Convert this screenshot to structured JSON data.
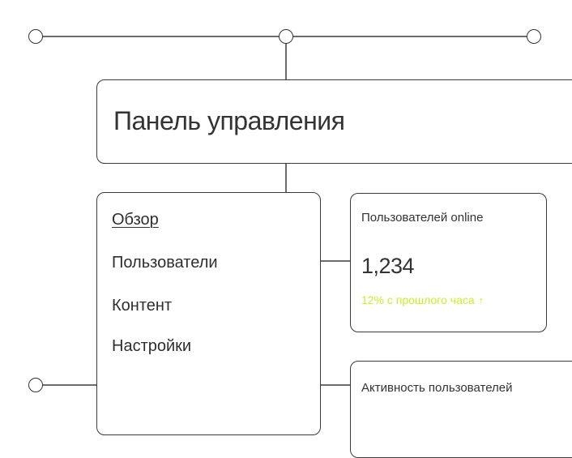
{
  "header": {
    "title": "Панель управления"
  },
  "sidebar": {
    "items": [
      {
        "label": "Обзор",
        "active": true
      },
      {
        "label": "Пользователи",
        "active": false
      },
      {
        "label": "Контент",
        "active": false
      },
      {
        "label": "Настройки",
        "active": false
      }
    ]
  },
  "stat_card": {
    "label": "Пользователей online",
    "value": "1,234",
    "change": "12% с прошлого часа",
    "trend_icon": "arrow-up-icon",
    "trend_color": "#c8ef2e"
  },
  "activity_card": {
    "title": "Активность пользователей"
  }
}
